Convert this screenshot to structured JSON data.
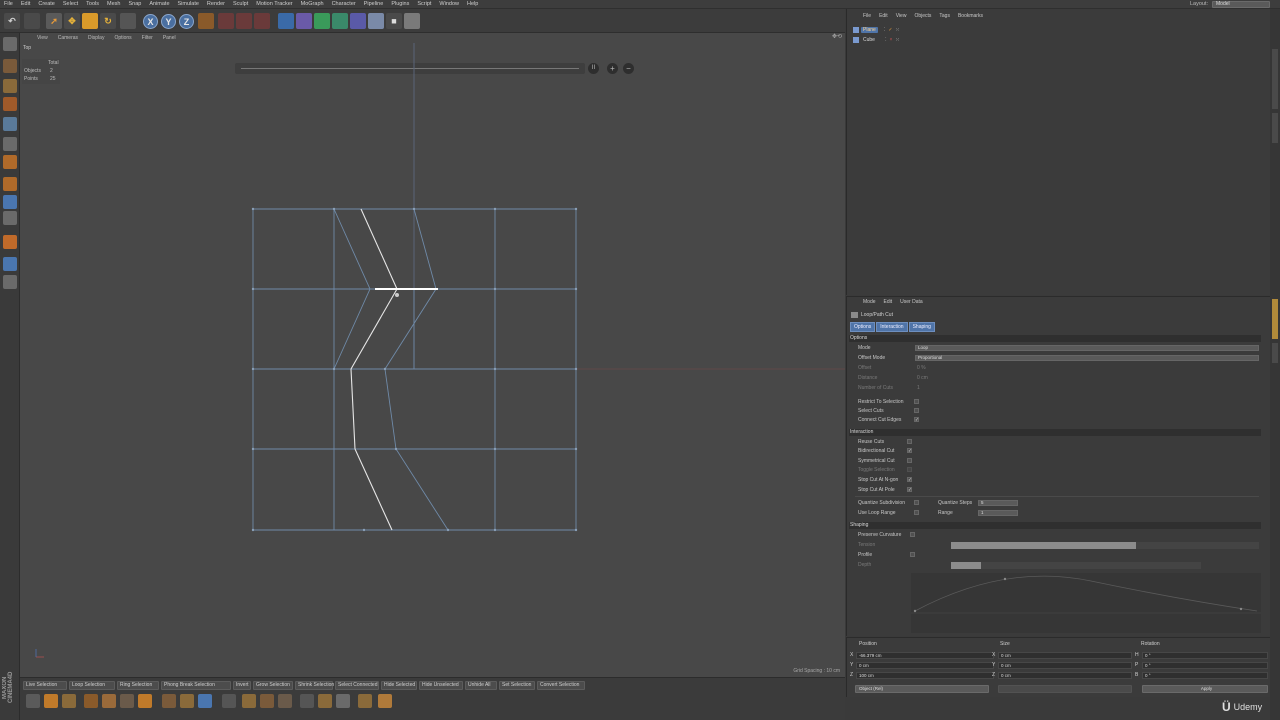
{
  "menubar": {
    "items": [
      "File",
      "Edit",
      "Create",
      "Select",
      "Tools",
      "Mesh",
      "Snap",
      "Animate",
      "Simulate",
      "Render",
      "Sculpt",
      "Motion Tracker",
      "MoGraph",
      "Character",
      "Pipeline",
      "Plugins",
      "Script",
      "Window",
      "Help"
    ],
    "layout_label": "Layout:",
    "layout_value": "Model"
  },
  "toolbar": {
    "axis_x": "X",
    "axis_y": "Y",
    "axis_z": "Z"
  },
  "viewport": {
    "menu": [
      "View",
      "Cameras",
      "Display",
      "Options",
      "Filter",
      "Panel"
    ],
    "label": "Top",
    "stats": {
      "header": "Total",
      "objects_label": "Objects",
      "objects_value": "2",
      "points_label": "Points",
      "points_value": "25"
    },
    "grid_spacing": "Grid Spacing : 10 cm",
    "colors": {
      "mesh": "#6f8aa8",
      "cut": "#e8e8e8"
    }
  },
  "commands": {
    "buttons": [
      "Live Selection",
      "Loop Selection",
      "Ring Selection",
      "Phong Break Selection",
      "Invert",
      "Grow Selection",
      "Shrink Selection",
      "Select Connected",
      "Hide Selected",
      "Hide Unselected",
      "Unhide All",
      "Set Selection",
      "Convert Selection"
    ]
  },
  "branding": {
    "maxon": "MAXON CINEMA4D",
    "udemy_logo": "Ü",
    "udemy": "Udemy"
  },
  "object_manager": {
    "menu": [
      "File",
      "Edit",
      "View",
      "Objects",
      "Tags",
      "Bookmarks"
    ],
    "objects": [
      {
        "name": "Plane",
        "selected": true
      },
      {
        "name": "Cube",
        "selected": false
      }
    ]
  },
  "attributes": {
    "menu": [
      "Mode",
      "Edit",
      "User Data"
    ],
    "title": "Loop/Path Cut",
    "tabs": [
      "Options",
      "Interaction",
      "Shaping"
    ],
    "sections": {
      "options": "Options",
      "interaction": "Interaction",
      "shaping": "Shaping"
    },
    "options": {
      "mode_label": "Mode",
      "mode_value": "Loop",
      "offset_mode_label": "Offset Mode",
      "offset_mode_value": "Proportional",
      "offset_label": "Offset",
      "offset_value": "0 %",
      "distance_label": "Distance",
      "distance_value": "0 cm",
      "num_cuts_label": "Number of Cuts",
      "num_cuts_value": "1",
      "restrict_label": "Restrict To Selection",
      "select_cuts_label": "Select Cuts",
      "connect_label": "Connect Cut Edges"
    },
    "interaction": {
      "reuse_label": "Reuse Cuts",
      "bidirectional_label": "Bidirectional Cut",
      "symmetrical_label": "Symmetrical Cut",
      "toggle_label": "Toggle Selection",
      "stop_ngon_label": "Stop Cut At N-gon",
      "stop_pole_label": "Stop Cut At Pole",
      "quantize_label": "Quantize Subdivision",
      "quantize_steps_label": "Quantize Steps",
      "quantize_steps_value": "5",
      "loop_range_label": "Use Loop Range",
      "range_label": "Range",
      "range_value": "1"
    },
    "shaping": {
      "preserve_label": "Preserve Curvature",
      "tension_label": "Tension",
      "profile_label": "Profile",
      "depth_label": "Depth",
      "tension_level": 0.6,
      "depth_level": 0.12
    }
  },
  "coordinates": {
    "position_header": "Position",
    "size_header": "Size",
    "rotation_header": "Rotation",
    "position": {
      "x": "-66.379 cm",
      "y": "0 cm",
      "z": "100 cm"
    },
    "size": {
      "x": "0 cm",
      "y": "0 cm",
      "z": "0 cm"
    },
    "rotation": {
      "h": "0 °",
      "p": "0 °",
      "b": "0 °"
    },
    "axis_labels": {
      "x": "X",
      "y": "Y",
      "z": "Z",
      "h": "H",
      "p": "P",
      "b": "B"
    },
    "mode_button": "Object (Rel)",
    "apply_button": "Apply"
  }
}
